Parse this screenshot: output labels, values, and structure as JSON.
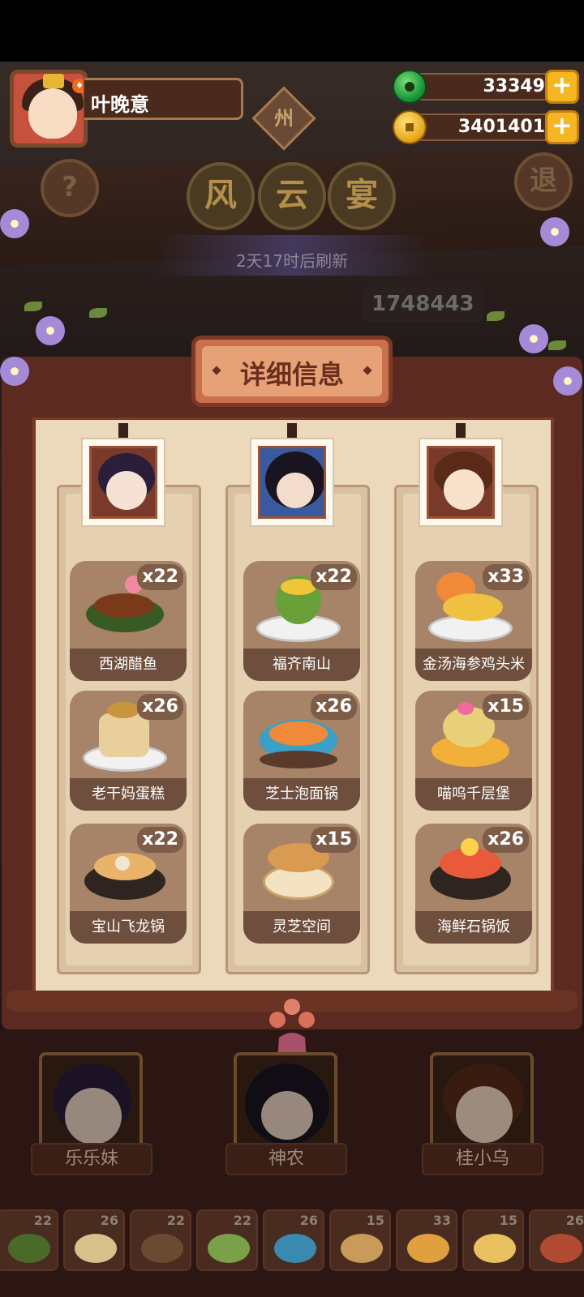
{
  "player": {
    "name": "叶晚意"
  },
  "currencies": {
    "jade": {
      "value": "33349",
      "icon": "jade-icon",
      "color": "#1c9a3a"
    },
    "coins": {
      "value": "3401401",
      "icon": "coin-icon",
      "color": "#e8a81d"
    }
  },
  "header": {
    "help_label": "?",
    "exit_label": "退",
    "region_label": "州",
    "event_title_chars": [
      "风",
      "云",
      "宴"
    ],
    "refresh_text": "2天17时后刷新",
    "score_text": "1748443"
  },
  "panel": {
    "title": "详细信息",
    "columns": [
      {
        "chef": "乐乐妹",
        "dishes": [
          {
            "name": "西湖醋鱼",
            "count": "x22"
          },
          {
            "name": "老干妈蛋糕",
            "count": "x26"
          },
          {
            "name": "宝山飞龙锅",
            "count": "x22"
          }
        ]
      },
      {
        "chef": "神农",
        "dishes": [
          {
            "name": "福齐南山",
            "count": "x22"
          },
          {
            "name": "芝士泡面锅",
            "count": "x26"
          },
          {
            "name": "灵芝空间",
            "count": "x15"
          }
        ]
      },
      {
        "chef": "桂小乌",
        "dishes": [
          {
            "name": "金汤海参鸡头米",
            "count": "x33"
          },
          {
            "name": "喵呜千层堡",
            "count": "x15"
          },
          {
            "name": "海鲜石锅饭",
            "count": "x26"
          }
        ]
      }
    ]
  },
  "bottom": {
    "chefs": [
      "乐乐妹",
      "神农",
      "桂小乌"
    ],
    "dish_counts": [
      "22",
      "26",
      "22",
      "22",
      "26",
      "15",
      "33",
      "15",
      "26"
    ]
  },
  "colors": {
    "panel_bg": "#ecd9bb",
    "frame": "#5c2a20",
    "plaque": "#e7a177",
    "label_bar": "#6e4e3c",
    "plus_button": "#f5b623"
  }
}
